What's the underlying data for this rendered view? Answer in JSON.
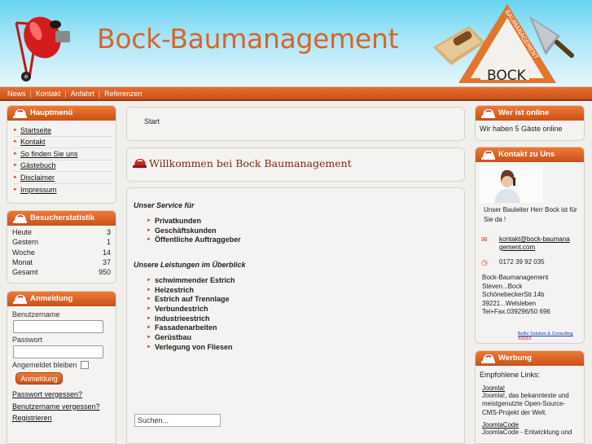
{
  "header": {
    "title": "Bock-Baumanagement",
    "logo_brand": "BOCK",
    "logo_arc_text": "BAUMANAGEMENT"
  },
  "nav": [
    "News",
    "Kontakt",
    "Anfahrt",
    "Referenzen"
  ],
  "hauptmenu": {
    "title": "Hauptmenü",
    "items": [
      "Startseite",
      "Kontakt",
      "So finden Sie uns",
      "Gästebuch",
      "Disclaimer",
      "Impressum"
    ]
  },
  "stats": {
    "title": "Besucherstatistik",
    "rows": [
      {
        "label": "Heute",
        "value": "3"
      },
      {
        "label": "Gestern",
        "value": "1"
      },
      {
        "label": "Woche",
        "value": "14"
      },
      {
        "label": "Monat",
        "value": "37"
      },
      {
        "label": "Gesamt",
        "value": "950"
      }
    ]
  },
  "login": {
    "title": "Anmeldung",
    "username_label": "Benutzername",
    "password_label": "Passwort",
    "remember_label": "Angemeldet bleiben",
    "button": "Anmeldung",
    "links": [
      "Passwort vergessen?",
      "Benutzername vergessen?",
      "Registrieren"
    ]
  },
  "main": {
    "breadcrumb": "Start",
    "article_title": "Willkommen bei Bock Baumanagement",
    "service_heading": "Unser Service für",
    "service_items": [
      "Privatkunden",
      "Geschäftskunden",
      "Öffentliche Auftraggeber"
    ],
    "leistungen_heading": "Unsere Leistungen im Überblick",
    "leistungen_items": [
      "schwimmender Estrich",
      "Heizestrich",
      "Estrich auf Trennlage",
      "Verbundestrich",
      "Industrieestrich",
      "Fassadenarbeiten",
      "Gerüstbau",
      "Verlegung von Fliesen"
    ],
    "search_placeholder": "Suchen..."
  },
  "online": {
    "title": "Wer ist online",
    "text": "Wir haben 5 Gäste online"
  },
  "contact": {
    "title": "Kontakt zu Uns",
    "caption": "Unser Bauleiter Herr Bock ist für Sie da !",
    "email": "kontakt@bock-baumanagement.com",
    "phone": "0172 39 92 035",
    "address": [
      "Bock-Baumanagement",
      "Steven...Bock",
      "SchönebeckerStr.14b",
      "39221...Welsleben",
      "Tel+Fax.039296/50 696"
    ],
    "credit_link": "BeBe Solution & Consulting",
    "credit_year": "©2010"
  },
  "werbung": {
    "title": "Werbung",
    "intro": "Empfohlene Links:",
    "entries": [
      {
        "link": "Joomla!",
        "text": "Joomla!, das bekannteste und meistgenutzte Open-Source-CMS-Projekt der Welt."
      },
      {
        "link": "JoomlaCode",
        "text": "JoomlaCode - Entwicklung und"
      }
    ]
  },
  "colors": {
    "accent": "#d8642a",
    "nav_orange": "#c8501a",
    "title_brown": "#7a2b10"
  }
}
